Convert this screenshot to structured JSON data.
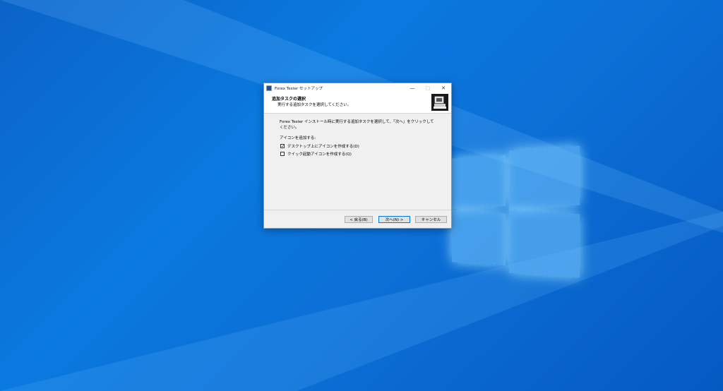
{
  "window": {
    "title": "Forex Tester セットアップ",
    "minimize_icon": "minimize-icon",
    "maximize_icon": "maximize-icon",
    "close_icon": "close-icon"
  },
  "header": {
    "title": "追加タスクの選択",
    "subtitle": "実行する追加タスクを選択してください。",
    "image_icon": "installer-computer-icon"
  },
  "content": {
    "description": "Forex Tester インストール時に実行する追加タスクを選択して、「次へ」をクリックしてください。",
    "group_label": "アイコンを追加する:",
    "options": [
      {
        "label": "デスクトップ上にアイコンを作成する(D)",
        "checked": true
      },
      {
        "label": "クイック起動アイコンを作成する(Q)",
        "checked": false
      }
    ]
  },
  "buttons": {
    "back": "< 戻る(B)",
    "next": "次へ(N) >",
    "cancel": "キャンセル"
  },
  "colors": {
    "desktop_blue": "#0a79df",
    "dialog_bg": "#f0f0f0",
    "accent": "#0078d7"
  }
}
